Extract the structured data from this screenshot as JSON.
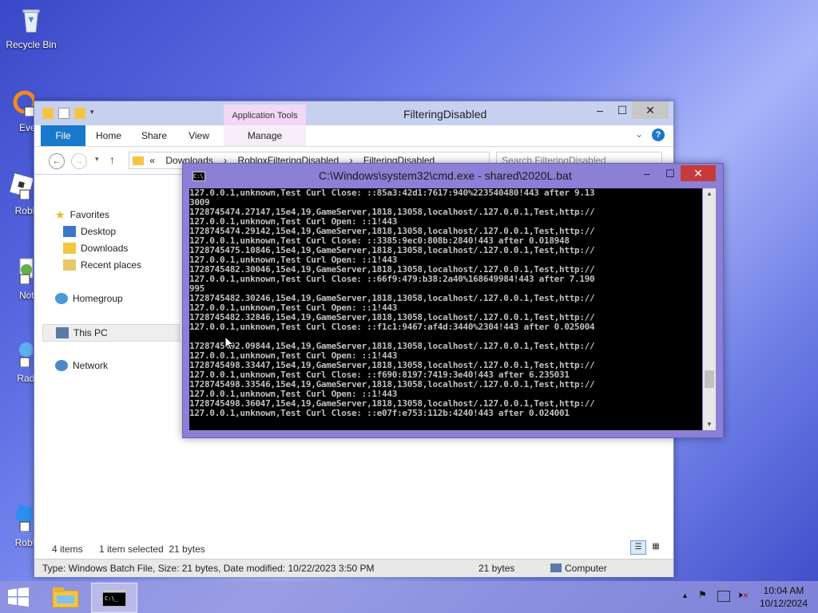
{
  "desktop": {
    "icons": [
      {
        "label": "Recycle Bin"
      },
      {
        "label": "Everyt"
      },
      {
        "label": "Roblox"
      },
      {
        "label": "Notep"
      },
      {
        "label": "Radmi"
      },
      {
        "label": "Roblox"
      }
    ]
  },
  "explorer": {
    "title": "FilteringDisabled",
    "app_tools": "Application Tools",
    "tabs": [
      "File",
      "Home",
      "Share",
      "View",
      "Manage"
    ],
    "address": {
      "prefix": "«",
      "crumbs": [
        "Downloads",
        "RobloxFilteringDisabled",
        "FilteringDisabled"
      ]
    },
    "search_placeholder": "Search FilteringDisabled",
    "nav": {
      "favorites": "Favorites",
      "favorites_items": [
        "Desktop",
        "Downloads",
        "Recent places"
      ],
      "homegroup": "Homegroup",
      "this_pc": "This PC",
      "network": "Network"
    },
    "status": {
      "items": "4 items",
      "selected": "1 item selected  21 bytes"
    },
    "details": {
      "info": "Type: Windows Batch File, Size: 21 bytes, Date modified: 10/22/2023 3:50 PM",
      "size": "21 bytes",
      "location": "Computer"
    }
  },
  "cmd": {
    "title": "C:\\Windows\\system32\\cmd.exe - shared\\2020L.bat",
    "lines": [
      "127.0.0.1,unknown,Test Curl Close: ::85a3:42d1:7617:940%223540480!443 after 9.13",
      "3009",
      "1728745474.27147,15e4,19,GameServer,1818,13058,localhost/.127.0.0.1,Test,http://",
      "127.0.0.1,unknown,Test Curl Open: ::1!443",
      "1728745474.29142,15e4,19,GameServer,1818,13058,localhost/.127.0.0.1,Test,http://",
      "127.0.0.1,unknown,Test Curl Close: ::3385:9ec0:808b:2840!443 after 0.018948",
      "1728745475.10846,15e4,19,GameServer,1818,13058,localhost/.127.0.0.1,Test,http://",
      "127.0.0.1,unknown,Test Curl Open: ::1!443",
      "1728745482.30046,15e4,19,GameServer,1818,13058,localhost/.127.0.0.1,Test,http://",
      "127.0.0.1,unknown,Test Curl Close: ::66f9:479:b38:2a40%168649984!443 after 7.190",
      "995",
      "1728745482.30246,15e4,19,GameServer,1818,13058,localhost/.127.0.0.1,Test,http://",
      "127.0.0.1,unknown,Test Curl Open: ::1!443",
      "1728745482.32846,15e4,19,GameServer,1818,13058,localhost/.127.0.0.1,Test,http://",
      "127.0.0.1,unknown,Test Curl Close: ::f1c1:9467:af4d:3440%2304!443 after 0.025004",
      "",
      "1728745492.09844,15e4,19,GameServer,1818,13058,localhost/.127.0.0.1,Test,http://",
      "127.0.0.1,unknown,Test Curl Open: ::1!443",
      "1728745498.33447,15e4,19,GameServer,1818,13058,localhost/.127.0.0.1,Test,http://",
      "127.0.0.1,unknown,Test Curl Close: ::f690:8197:7419:3e40!443 after 6.235031",
      "1728745498.33546,15e4,19,GameServer,1818,13058,localhost/.127.0.0.1,Test,http://",
      "127.0.0.1,unknown,Test Curl Open: ::1!443",
      "1728745498.36047,15e4,19,GameServer,1818,13058,localhost/.127.0.0.1,Test,http://",
      "127.0.0.1,unknown,Test Curl Close: ::e07f:e753:112b:4240!443 after 0.024001"
    ]
  },
  "taskbar": {
    "time": "10:04 AM",
    "date": "10/12/2024"
  },
  "colors": {
    "file_tab": "#1979ca",
    "cmd_frame": "#8b7fd6",
    "close_red": "#c73a3a",
    "app_tools_tab": "#f2d8f4"
  }
}
